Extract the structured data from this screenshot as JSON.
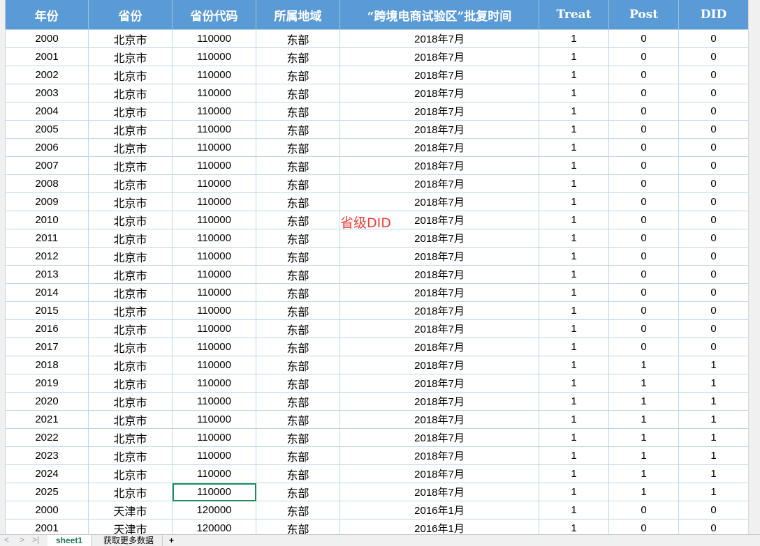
{
  "columns": [
    "年份",
    "省份",
    "省份代码",
    "所属地域",
    "“跨境电商试验区”批复时间",
    "Treat",
    "Post",
    "DID"
  ],
  "rows": [
    [
      "2000",
      "北京市",
      "110000",
      "东部",
      "2018年7月",
      "1",
      "0",
      "0"
    ],
    [
      "2001",
      "北京市",
      "110000",
      "东部",
      "2018年7月",
      "1",
      "0",
      "0"
    ],
    [
      "2002",
      "北京市",
      "110000",
      "东部",
      "2018年7月",
      "1",
      "0",
      "0"
    ],
    [
      "2003",
      "北京市",
      "110000",
      "东部",
      "2018年7月",
      "1",
      "0",
      "0"
    ],
    [
      "2004",
      "北京市",
      "110000",
      "东部",
      "2018年7月",
      "1",
      "0",
      "0"
    ],
    [
      "2005",
      "北京市",
      "110000",
      "东部",
      "2018年7月",
      "1",
      "0",
      "0"
    ],
    [
      "2006",
      "北京市",
      "110000",
      "东部",
      "2018年7月",
      "1",
      "0",
      "0"
    ],
    [
      "2007",
      "北京市",
      "110000",
      "东部",
      "2018年7月",
      "1",
      "0",
      "0"
    ],
    [
      "2008",
      "北京市",
      "110000",
      "东部",
      "2018年7月",
      "1",
      "0",
      "0"
    ],
    [
      "2009",
      "北京市",
      "110000",
      "东部",
      "2018年7月",
      "1",
      "0",
      "0"
    ],
    [
      "2010",
      "北京市",
      "110000",
      "东部",
      "2018年7月",
      "1",
      "0",
      "0"
    ],
    [
      "2011",
      "北京市",
      "110000",
      "东部",
      "2018年7月",
      "1",
      "0",
      "0"
    ],
    [
      "2012",
      "北京市",
      "110000",
      "东部",
      "2018年7月",
      "1",
      "0",
      "0"
    ],
    [
      "2013",
      "北京市",
      "110000",
      "东部",
      "2018年7月",
      "1",
      "0",
      "0"
    ],
    [
      "2014",
      "北京市",
      "110000",
      "东部",
      "2018年7月",
      "1",
      "0",
      "0"
    ],
    [
      "2015",
      "北京市",
      "110000",
      "东部",
      "2018年7月",
      "1",
      "0",
      "0"
    ],
    [
      "2016",
      "北京市",
      "110000",
      "东部",
      "2018年7月",
      "1",
      "0",
      "0"
    ],
    [
      "2017",
      "北京市",
      "110000",
      "东部",
      "2018年7月",
      "1",
      "0",
      "0"
    ],
    [
      "2018",
      "北京市",
      "110000",
      "东部",
      "2018年7月",
      "1",
      "1",
      "1"
    ],
    [
      "2019",
      "北京市",
      "110000",
      "东部",
      "2018年7月",
      "1",
      "1",
      "1"
    ],
    [
      "2020",
      "北京市",
      "110000",
      "东部",
      "2018年7月",
      "1",
      "1",
      "1"
    ],
    [
      "2021",
      "北京市",
      "110000",
      "东部",
      "2018年7月",
      "1",
      "1",
      "1"
    ],
    [
      "2022",
      "北京市",
      "110000",
      "东部",
      "2018年7月",
      "1",
      "1",
      "1"
    ],
    [
      "2023",
      "北京市",
      "110000",
      "东部",
      "2018年7月",
      "1",
      "1",
      "1"
    ],
    [
      "2024",
      "北京市",
      "110000",
      "东部",
      "2018年7月",
      "1",
      "1",
      "1"
    ],
    [
      "2025",
      "北京市",
      "110000",
      "东部",
      "2018年7月",
      "1",
      "1",
      "1"
    ],
    [
      "2000",
      "天津市",
      "120000",
      "东部",
      "2016年1月",
      "1",
      "0",
      "0"
    ],
    [
      "2001",
      "天津市",
      "120000",
      "东部",
      "2016年1月",
      "1",
      "0",
      "0"
    ]
  ],
  "selected": {
    "row": 25,
    "col": 2
  },
  "overlay_text": "省级DID",
  "sheet_tabs": [
    "sheet1",
    "获取更多数据"
  ],
  "add_sheet": "+",
  "nav": [
    "<",
    ">",
    ">|"
  ]
}
